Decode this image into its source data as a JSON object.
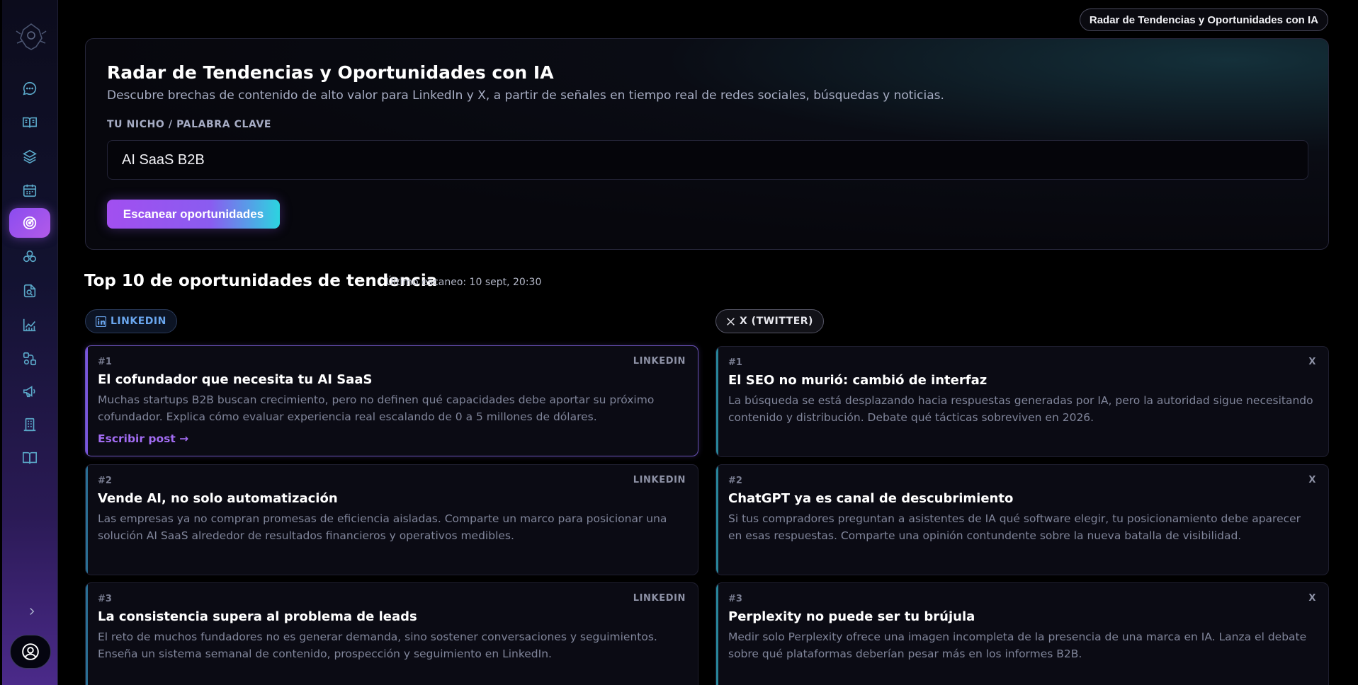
{
  "app": {
    "top_pill": "Radar de Tendencias y Oportunidades con IA"
  },
  "sidebar": {
    "items": [
      {
        "icon": "chat-icon"
      },
      {
        "icon": "book-open-icon"
      },
      {
        "icon": "layers-icon"
      },
      {
        "icon": "calendar-icon"
      },
      {
        "icon": "radar-icon",
        "active": true
      },
      {
        "icon": "circles-icon"
      },
      {
        "icon": "file-search-icon"
      },
      {
        "icon": "chart-line-icon"
      },
      {
        "icon": "workflow-icon"
      },
      {
        "icon": "megaphone-icon"
      },
      {
        "icon": "building-icon"
      },
      {
        "icon": "book-icon"
      }
    ],
    "expand_icon": "chevron-right-icon",
    "avatar_icon": "user-circle-icon"
  },
  "hero": {
    "title": "Radar de Tendencias y Oportunidades con IA",
    "subtitle": "Descubre brechas de contenido de alto valor para LinkedIn y X, a partir de señales en tiempo real de redes sociales, búsquedas y noticias.",
    "field_label": "TU NICHO / PALABRA CLAVE",
    "field_value": "AI SaaS B2B",
    "scan_button": "Escanear oportunidades"
  },
  "results": {
    "title": "Top 10 de oportunidades de tendencia",
    "last_scan": "Último escaneo: 10 sept, 20:30",
    "linkedin_pill": "LINKEDIN",
    "x_pill": "X (TWITTER)",
    "linkedin_cards": [
      {
        "rank": "#1",
        "platform": "LINKEDIN",
        "title": "El cofundador que necesita tu AI SaaS",
        "description": "Muchas startups B2B buscan crecimiento, pero no definen qué capacidades debe aportar su próximo cofundador. Explica cómo evaluar experiencia real escalando de 0 a 5 millones de dólares.",
        "link": "Escribir post →"
      },
      {
        "rank": "#2",
        "platform": "LINKEDIN",
        "title": "Vende AI, no solo automatización",
        "description": "Las empresas ya no compran promesas de eficiencia aisladas. Comparte un marco para posicionar una solución AI SaaS alrededor de resultados financieros y operativos medibles."
      },
      {
        "rank": "#3",
        "platform": "LINKEDIN",
        "title": "La consistencia supera al problema de leads",
        "description": "El reto de muchos fundadores no es generar demanda, sino sostener conversaciones y seguimientos. Enseña un sistema semanal de contenido, prospección y seguimiento en LinkedIn."
      }
    ],
    "x_cards": [
      {
        "rank": "#1",
        "platform": "X",
        "title": "El SEO no murió: cambió de interfaz",
        "description": "La búsqueda se está desplazando hacia respuestas generadas por IA, pero la autoridad sigue necesitando contenido y distribución. Debate qué tácticas sobreviven en 2026."
      },
      {
        "rank": "#2",
        "platform": "X",
        "title": "ChatGPT ya es canal de descubrimiento",
        "description": "Si tus compradores preguntan a asistentes de IA qué software elegir, tu posicionamiento debe aparecer en esas respuestas. Comparte una opinión contundente sobre la nueva batalla de visibilidad."
      },
      {
        "rank": "#3",
        "platform": "X",
        "title": "Perplexity no puede ser tu brújula",
        "description": "Medir solo Perplexity ofrece una imagen incompleta de la presencia de una marca en IA. Lanza el debate sobre qué plataformas deberían pesar más en los informes B2B."
      }
    ]
  },
  "colors": {
    "accent_purple": "#a24ff0",
    "accent_cyan": "#2cd4e0",
    "linkedin_blue": "#6aa6ee",
    "link_purple": "#a26cf2"
  }
}
